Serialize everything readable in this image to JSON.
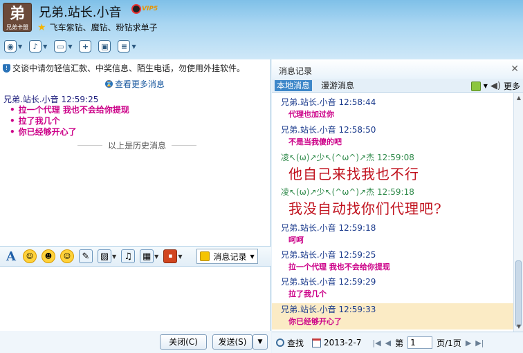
{
  "header": {
    "avatar_text": "弟",
    "avatar_sub": "兄弟卡盟",
    "nickname": "兄弟.站长.小音",
    "vip_label": "VIP5",
    "signature": "飞车紫钻、魔钻、粉钻求单子"
  },
  "left": {
    "notice": "交谈中请勿轻信汇款、中奖信息、陌生电话，勿使用外挂软件。",
    "view_more": "查看更多消息",
    "history": {
      "sender_line": "兄弟.站长.小音   12:59:25",
      "lines": [
        "拉一个代理  我也不会给你提现",
        "拉了我几个",
        "你已经够开心了"
      ],
      "end_label": "以上是历史消息"
    },
    "toolbar": {
      "msg_record_label": "消息记录"
    },
    "buttons": {
      "close": "关闭(C)",
      "send": "发送(S)"
    }
  },
  "right": {
    "title": "消息记录",
    "tabs": [
      "本地消息",
      "漫游消息"
    ],
    "more": "更多",
    "entries": [
      {
        "sender": "兄弟.站长.小音  12:58:44",
        "text": "代理也加过你",
        "style": "normal",
        "color": "blue"
      },
      {
        "sender": "兄弟.站长.小音  12:58:50",
        "text": "不是当我傻的吧",
        "style": "normal",
        "color": "blue"
      },
      {
        "sender": "凌↖(ω)↗少↖(^ω^)↗杰  12:59:08",
        "text": "他自己来找我也不行",
        "style": "big",
        "color": "green"
      },
      {
        "sender": "凌↖(ω)↗少↖(^ω^)↗杰  12:59:18",
        "text": "我没自动找你们代理吧?",
        "style": "big",
        "color": "green"
      },
      {
        "sender": "兄弟.站长.小音  12:59:18",
        "text": "呵呵",
        "style": "normal",
        "color": "blue"
      },
      {
        "sender": "兄弟.站长.小音  12:59:25",
        "text": "拉一个代理  我也不会给你提现",
        "style": "normal",
        "color": "blue"
      },
      {
        "sender": "兄弟.站长.小音  12:59:29",
        "text": "拉了我几个",
        "style": "normal",
        "color": "blue"
      },
      {
        "sender": "兄弟.站长.小音  12:59:33",
        "text": "你已经够开心了",
        "style": "normal",
        "color": "blue",
        "highlight": true
      }
    ],
    "footer": {
      "find": "查找",
      "date": "2013-2-7",
      "page_prefix": "第",
      "page_value": "1",
      "page_suffix": "页/1页"
    }
  }
}
